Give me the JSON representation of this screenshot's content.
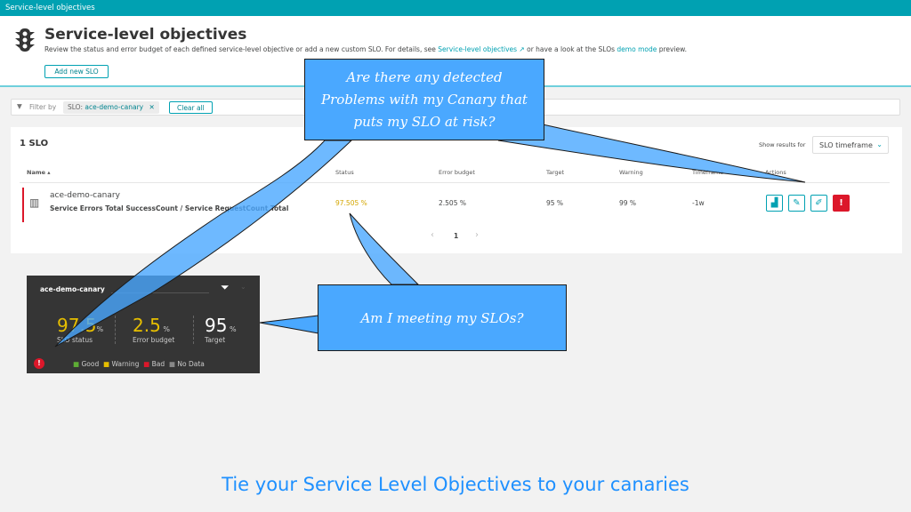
{
  "topbar": {
    "title": "Service-level objectives"
  },
  "header": {
    "title": "Service-level objectives",
    "description_pre": "Review the status and error budget of each defined service-level objective or add a new custom SLO. For details, see ",
    "link1": "Service-level objectives",
    "description_mid": " or have a look at the SLOs ",
    "link2": "demo mode",
    "description_post": " preview.",
    "add_button": "Add new SLO"
  },
  "filter": {
    "label": "Filter by",
    "chip_key": "SLO:",
    "chip_value": "ace-demo-canary",
    "clear": "Clear all"
  },
  "list": {
    "count": "1 SLO",
    "show_results_label": "Show results for",
    "timeframe_select": "SLO timeframe",
    "columns": [
      "Name",
      "Status",
      "Error budget",
      "Target",
      "Warning",
      "Timeframe",
      "Actions"
    ],
    "rows": [
      {
        "name": "ace-demo-canary",
        "metric": "Service Errors Total SuccessCount / Service RequestCount Total",
        "status": "97.505 %",
        "error_budget": "2.505 %",
        "target": "95 %",
        "warning": "99 %",
        "timeframe": "-1w"
      }
    ],
    "page": "1"
  },
  "widget": {
    "title": "ace-demo-canary",
    "status_value": "97.5",
    "status_label": "SLO status",
    "budget_value": "2.5",
    "budget_label": "Error budget",
    "target_value": "95",
    "target_label": "Target",
    "unit": "%",
    "legend": [
      "Good",
      "Warning",
      "Bad",
      "No Data"
    ]
  },
  "callouts": {
    "problems": "Are there any detected Problems with my Canary that puts my SLO at risk?",
    "meeting": "Am I meeting my SLOs?"
  },
  "caption": "Tie your Service Level Objectives to your canaries",
  "colors": {
    "brand": "#00a1b2",
    "warning": "#e6be00",
    "error": "#dc172a",
    "good": "#5ead35",
    "callout": "#4aa8ff"
  }
}
